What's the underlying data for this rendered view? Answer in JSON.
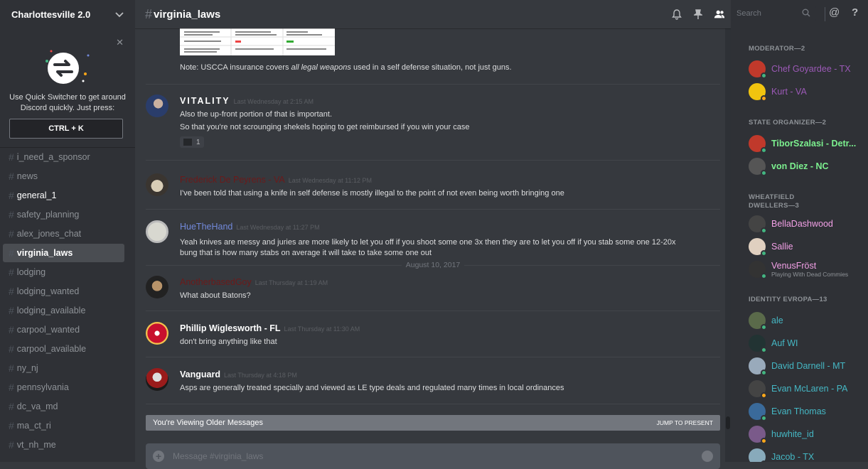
{
  "guild": {
    "name": "Charlottesville 2.0"
  },
  "quick_switcher": {
    "text": "Use Quick Switcher to get around Discord quickly. Just press:",
    "shortcut": "CTRL + K"
  },
  "channels": [
    {
      "name": "i_need_a_sponsor",
      "state": "normal"
    },
    {
      "name": "news",
      "state": "normal"
    },
    {
      "name": "general_1",
      "state": "unread"
    },
    {
      "name": "safety_planning",
      "state": "normal"
    },
    {
      "name": "alex_jones_chat",
      "state": "normal"
    },
    {
      "name": "virginia_laws",
      "state": "active"
    },
    {
      "name": "lodging",
      "state": "normal"
    },
    {
      "name": "lodging_wanted",
      "state": "normal"
    },
    {
      "name": "lodging_available",
      "state": "normal"
    },
    {
      "name": "carpool_wanted",
      "state": "normal"
    },
    {
      "name": "carpool_available",
      "state": "normal"
    },
    {
      "name": "ny_nj",
      "state": "normal"
    },
    {
      "name": "pennsylvania",
      "state": "normal"
    },
    {
      "name": "dc_va_md",
      "state": "normal"
    },
    {
      "name": "ma_ct_ri",
      "state": "normal"
    },
    {
      "name": "vt_nh_me",
      "state": "normal"
    }
  ],
  "header": {
    "hash": "#",
    "channel": "virginia_laws",
    "search_placeholder": "Search",
    "mention_icon": "@",
    "help_icon": "?"
  },
  "messages": {
    "note": {
      "prefix": "Note: USCCA insurance covers ",
      "emphasis": "all legal weapons",
      "suffix": " used in a self defense situation, not just guns."
    },
    "m1": {
      "author": "VITALITY",
      "time": "Last Wednesday at 2:15 AM",
      "lines": [
        "Also the up-front portion of that is important.",
        "So that you're not scrounging shekels hoping to get reimbursed if you win your case"
      ],
      "reaction_count": "1",
      "color": "#ffffff"
    },
    "m2": {
      "author": "Frederick De Peyrens - VA",
      "time": "Last Wednesday at 11:12 PM",
      "lines": [
        "I've been told that using a knife in self defense is mostly illegal to the point of not even being worth bringing one"
      ],
      "color": "#6b1a1a"
    },
    "m3": {
      "author": "HueTheHand",
      "time": "Last Wednesday at 11:27 PM",
      "lines": [
        "Yeah knives are messy and juries are more likely to let you off if you shoot some one 3x then they are to let you off if you stab some one 12-20x",
        "bung that is how many stabs on average it will take to take some one out"
      ],
      "color": "#7289da"
    },
    "date": "August 10, 2017",
    "m4": {
      "author": "AnotherbasedGoy",
      "time": "Last Thursday at 1:19 AM",
      "lines": [
        "What about Batons?"
      ],
      "color": "#6b1a1a"
    },
    "m5": {
      "author": "Phillip Wiglesworth - FL",
      "time": "Last Thursday at 11:30 AM",
      "lines": [
        "don't bring anything like that"
      ],
      "color": "#ffffff"
    },
    "m6": {
      "author": "Vanguard",
      "time": "Last Thursday at 4:18 PM",
      "lines": [
        "Asps are generally treated specially and viewed as LE type deals and regulated many times in local ordinances"
      ],
      "color": "#ffffff"
    }
  },
  "older_bar": {
    "text": "You're Viewing Older Messages",
    "jump": "JUMP TO PRESENT"
  },
  "composer": {
    "placeholder": "Message #virginia_laws"
  },
  "members": {
    "roles": [
      {
        "title": "MODERATOR—2"
      },
      {
        "title": "STATE ORGANIZER—2"
      },
      {
        "title": "WHEATFIELD DWELLERS—3"
      },
      {
        "title": "IDENTITY EVROPA—13"
      }
    ],
    "list": [
      {
        "name": "Chef Goyardee - TX",
        "color": "#9b59b6",
        "status": "#43b581",
        "bold": false,
        "sub": ""
      },
      {
        "name": "Kurt - VA",
        "color": "#9b59b6",
        "status": "#faa61a",
        "bold": false,
        "sub": ""
      },
      {
        "name": "TiborSzalasi - Detr...",
        "color": "#7cf08f",
        "status": "#43b581",
        "bold": true,
        "sub": ""
      },
      {
        "name": "von Diez - NC",
        "color": "#7cf08f",
        "status": "#43b581",
        "bold": true,
        "sub": ""
      },
      {
        "name": "BellaDashwood",
        "color": "#f2a0e6",
        "status": "#43b581",
        "bold": false,
        "sub": ""
      },
      {
        "name": "Sallie",
        "color": "#f2a0e6",
        "status": "#43b581",
        "bold": false,
        "sub": ""
      },
      {
        "name": "VenusFröst",
        "color": "#f2a0e6",
        "status": "#43b581",
        "bold": false,
        "sub": "Playing With Dead Commies"
      },
      {
        "name": "ale",
        "color": "#45b7c4",
        "status": "#43b581",
        "bold": false,
        "sub": ""
      },
      {
        "name": "Auf WI",
        "color": "#45b7c4",
        "status": "#43b581",
        "bold": false,
        "sub": ""
      },
      {
        "name": "David Darnell - MT",
        "color": "#45b7c4",
        "status": "#43b581",
        "bold": false,
        "sub": ""
      },
      {
        "name": "Evan McLaren - PA",
        "color": "#45b7c4",
        "status": "#faa61a",
        "bold": false,
        "sub": ""
      },
      {
        "name": "Evan Thomas",
        "color": "#45b7c4",
        "status": "#43b581",
        "bold": false,
        "sub": ""
      },
      {
        "name": "huwhite_id",
        "color": "#45b7c4",
        "status": "#faa61a",
        "bold": false,
        "sub": ""
      },
      {
        "name": "Jacob - TX",
        "color": "#45b7c4",
        "status": "#43b581",
        "bold": false,
        "sub": ""
      }
    ]
  }
}
